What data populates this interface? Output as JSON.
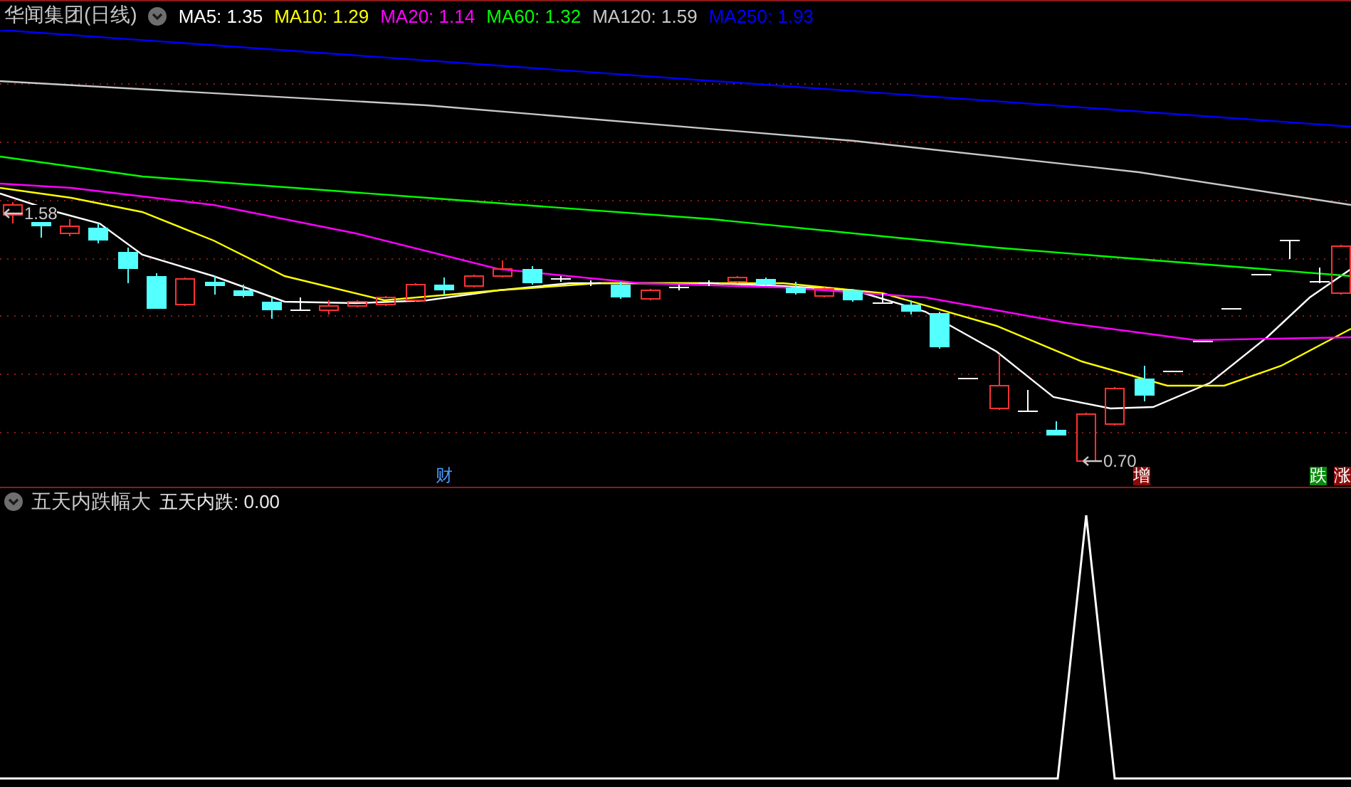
{
  "header": {
    "title": "华闻集团(日线)",
    "moving_averages": [
      {
        "text": "MA5: 1.35",
        "color": "#ffffff"
      },
      {
        "text": "MA10: 1.29",
        "color": "#ffff00"
      },
      {
        "text": "MA20: 1.14",
        "color": "#ff00ff"
      },
      {
        "text": "MA60: 1.32",
        "color": "#00ff00"
      },
      {
        "text": "MA120: 1.59",
        "color": "#c8c8c8"
      },
      {
        "text": "MA250: 1.93",
        "color": "#0000ff"
      }
    ]
  },
  "price_chart": {
    "annotations": [
      {
        "text": "1.58"
      },
      {
        "text": "0.70"
      }
    ],
    "markers": [
      {
        "text": "财",
        "kind": "label",
        "color": "#4a9cff"
      },
      {
        "text": "增",
        "kind": "badge",
        "color": "#8b0a0a"
      },
      {
        "text": "跌",
        "kind": "badge",
        "color": "#0a8a0a"
      },
      {
        "text": "涨",
        "kind": "badge",
        "color": "#8b0a0a"
      }
    ]
  },
  "indicator": {
    "title": "五天内跌幅大",
    "reading": "五天内跌: 0.00"
  }
}
